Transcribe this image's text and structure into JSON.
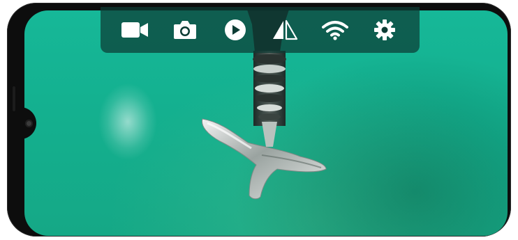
{
  "toolbar": {
    "items": [
      {
        "icon": "video-camera-icon",
        "name": "record-video-button"
      },
      {
        "icon": "camera-icon",
        "name": "take-photo-button"
      },
      {
        "icon": "play-icon",
        "name": "play-button"
      },
      {
        "icon": "mirror-flip-icon",
        "name": "mirror-button"
      },
      {
        "icon": "wifi-icon",
        "name": "wifi-button"
      },
      {
        "icon": "gear-icon",
        "name": "settings-button"
      }
    ],
    "icon_color": "#ffffff",
    "background_color": "#0c3c34"
  },
  "screen": {
    "background_color": "#16b898"
  }
}
